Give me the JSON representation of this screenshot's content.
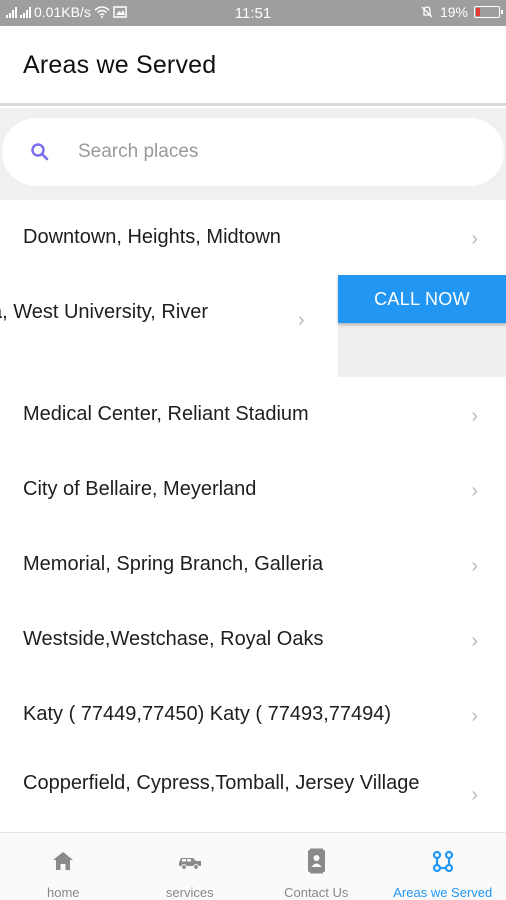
{
  "status_bar": {
    "network_speed": "0.01KB/s",
    "time": "11:51",
    "battery_percent": "19%",
    "battery_level": 0.19
  },
  "header": {
    "title": "Areas we Served"
  },
  "search": {
    "placeholder": "Search places",
    "value": ""
  },
  "areas": [
    "Downtown, Heights, Midtown",
    "a, West University, River",
    "Medical Center, Reliant Stadium",
    "City of Bellaire, Meyerland",
    "Memorial, Spring Branch, Galleria",
    "Westside,Westchase, Royal Oaks",
    "Katy ( 77449,77450) Katy ( 77493,77494)",
    "Copperfield, Cypress,Tomball, Jersey Village"
  ],
  "swipe_action": {
    "label": "CALL NOW",
    "color": "#2196f3"
  },
  "bottom_nav": [
    {
      "label": "home",
      "icon": "home-icon"
    },
    {
      "label": "services",
      "icon": "car-icon"
    },
    {
      "label": "Contact Us",
      "icon": "contacts-icon"
    },
    {
      "label": "Areas we Served",
      "icon": "route-icon",
      "active": true
    }
  ],
  "colors": {
    "accent": "#2196f3",
    "status_bar": "#9e9e9e",
    "battery_low": "#e53935"
  }
}
